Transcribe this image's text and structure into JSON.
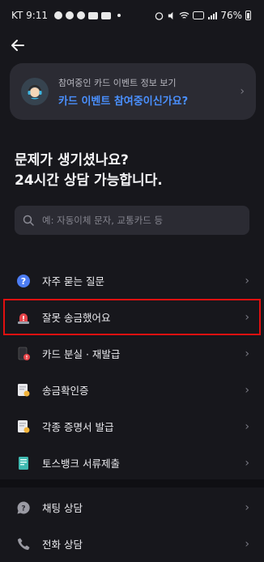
{
  "statusbar": {
    "carrier_time": "KT 9:11",
    "battery": "76%"
  },
  "event_card": {
    "subtitle": "참여중인 카드 이벤트 정보 보기",
    "title": "카드 이벤트 참여중이신가요?"
  },
  "headline": {
    "line1": "문제가 생기셨나요?",
    "line2": "24시간 상담 가능합니다."
  },
  "search": {
    "placeholder": "예: 자동이체 문자, 교통카드 등"
  },
  "menu": [
    {
      "label": "자주 묻는 질문",
      "icon": "question-icon"
    },
    {
      "label": "잘못 송금했어요",
      "icon": "siren-icon"
    },
    {
      "label": "카드 분실 · 재발급",
      "icon": "card-lost-icon"
    },
    {
      "label": "송금확인증",
      "icon": "certificate-icon"
    },
    {
      "label": "각종 증명서 발급",
      "icon": "document-icon"
    },
    {
      "label": "토스뱅크 서류제출",
      "icon": "submit-document-icon"
    }
  ],
  "menu2": [
    {
      "label": "채팅 상담",
      "icon": "chat-icon"
    },
    {
      "label": "전화 상담",
      "icon": "phone-icon"
    }
  ],
  "colors": {
    "accent": "#4a90ff",
    "highlight_border": "#e01010",
    "background": "#17171c"
  }
}
